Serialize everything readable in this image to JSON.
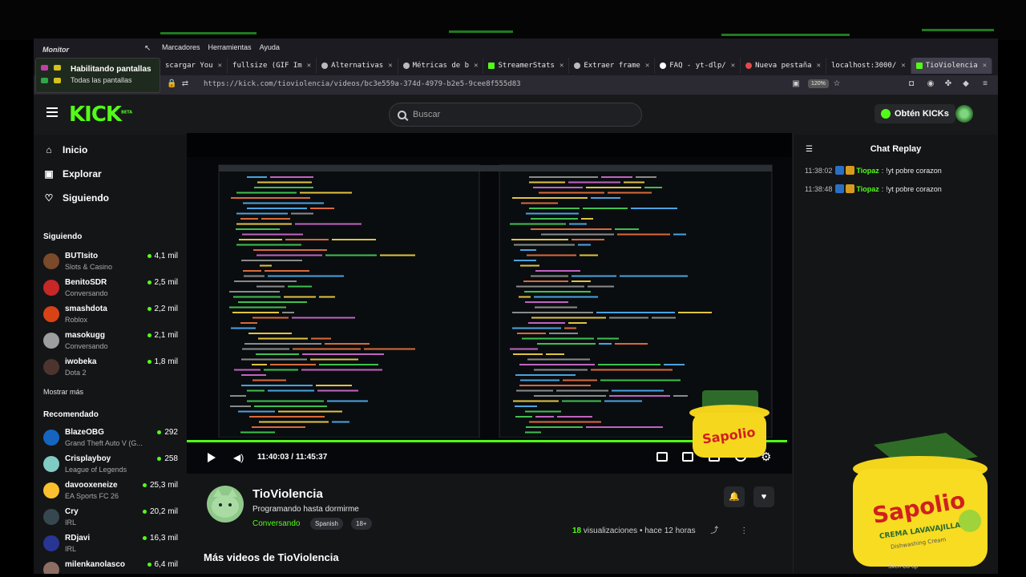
{
  "os": {
    "monitor_label": "Monitor",
    "notification": {
      "title": "Habilitando pantallas",
      "subtitle": "Todas las pantallas"
    },
    "corner_text": "Sven Co-op"
  },
  "browser": {
    "menu": [
      "Marcadores",
      "Herramientas",
      "Ayuda"
    ],
    "tabs": [
      {
        "label": "scargar You",
        "active": false
      },
      {
        "label": "fullsize (GIF Im",
        "active": false
      },
      {
        "label": "Alternativas",
        "active": false
      },
      {
        "label": "Métricas de b",
        "active": false
      },
      {
        "label": "StreamerStats",
        "active": false
      },
      {
        "label": "Extraer frame",
        "active": false
      },
      {
        "label": "FAQ - yt-dlp/",
        "active": false
      },
      {
        "label": "Nueva pestaña",
        "active": false
      },
      {
        "label": "localhost:3000/",
        "active": false
      },
      {
        "label": "TioViolencia",
        "active": true
      }
    ],
    "url": "https://kick.com/tioviolencia/videos/bc3e559a-374d-4979-b2e5-9cee8f555d83",
    "zoom": "120%"
  },
  "kick": {
    "logo": "KICK",
    "logo_tag": "BETA",
    "search_placeholder": "Buscar",
    "kicks_button": "Obtén KICKs",
    "nav": [
      {
        "label": "Inicio",
        "icon": "home-icon"
      },
      {
        "label": "Explorar",
        "icon": "compass-icon"
      },
      {
        "label": "Siguiendo",
        "icon": "heart-icon"
      }
    ],
    "following_title": "Siguiendo",
    "following": [
      {
        "name": "BUTIsito",
        "category": "Slots & Casino",
        "viewers": "4,1 mil",
        "color": "#7a4a2a"
      },
      {
        "name": "BenitoSDR",
        "category": "Conversando",
        "viewers": "2,5 mil",
        "color": "#c62828"
      },
      {
        "name": "smashdota",
        "category": "Roblox",
        "viewers": "2,2 mil",
        "color": "#d84315"
      },
      {
        "name": "masokugg",
        "category": "Conversando",
        "viewers": "2,1 mil",
        "color": "#9e9e9e"
      },
      {
        "name": "iwobeka",
        "category": "Dota 2",
        "viewers": "1,8 mil",
        "color": "#4e342e"
      }
    ],
    "show_more": "Mostrar más",
    "recommended_title": "Recomendado",
    "recommended": [
      {
        "name": "BlazeOBG",
        "category": "Grand Theft Auto V (G...",
        "viewers": "292",
        "color": "#1565c0"
      },
      {
        "name": "Crisplayboy",
        "category": "League of Legends",
        "viewers": "258",
        "color": "#80cbc4"
      },
      {
        "name": "davooxeneize",
        "category": "EA Sports FC 26",
        "viewers": "25,3 mil",
        "color": "#fbc02d"
      },
      {
        "name": "Cry",
        "category": "IRL",
        "viewers": "20,2 mil",
        "color": "#37474f"
      },
      {
        "name": "RDjavi",
        "category": "IRL",
        "viewers": "16,3 mil",
        "color": "#283593"
      },
      {
        "name": "milenkanolasco",
        "category": "",
        "viewers": "6,4 mil",
        "color": "#8d6e63"
      }
    ],
    "video": {
      "current_time": "11:40:03",
      "separator": "/",
      "duration": "11:45:37",
      "progress": 0.992
    },
    "channel": {
      "name": "TioViolencia",
      "title": "Programando hasta dormirme",
      "category": "Conversando",
      "tags": [
        "Spanish",
        "18+"
      ],
      "views_count": "18",
      "views_label": "visualizaciones",
      "ago": "hace 12 horas"
    },
    "more_videos": "Más videos de TioViolencia",
    "chat": {
      "title": "Chat Replay",
      "messages": [
        {
          "time": "11:38:02",
          "user": "Tiopaz",
          "text": "!yt pobre corazon"
        },
        {
          "time": "11:38:48",
          "user": "Tiopaz",
          "text": "!yt pobre corazon"
        }
      ]
    }
  },
  "product": {
    "brand": "Sapolio",
    "sub": "CREMA LAVAVAJILLA",
    "tagline": "Dishwashing Cream"
  }
}
